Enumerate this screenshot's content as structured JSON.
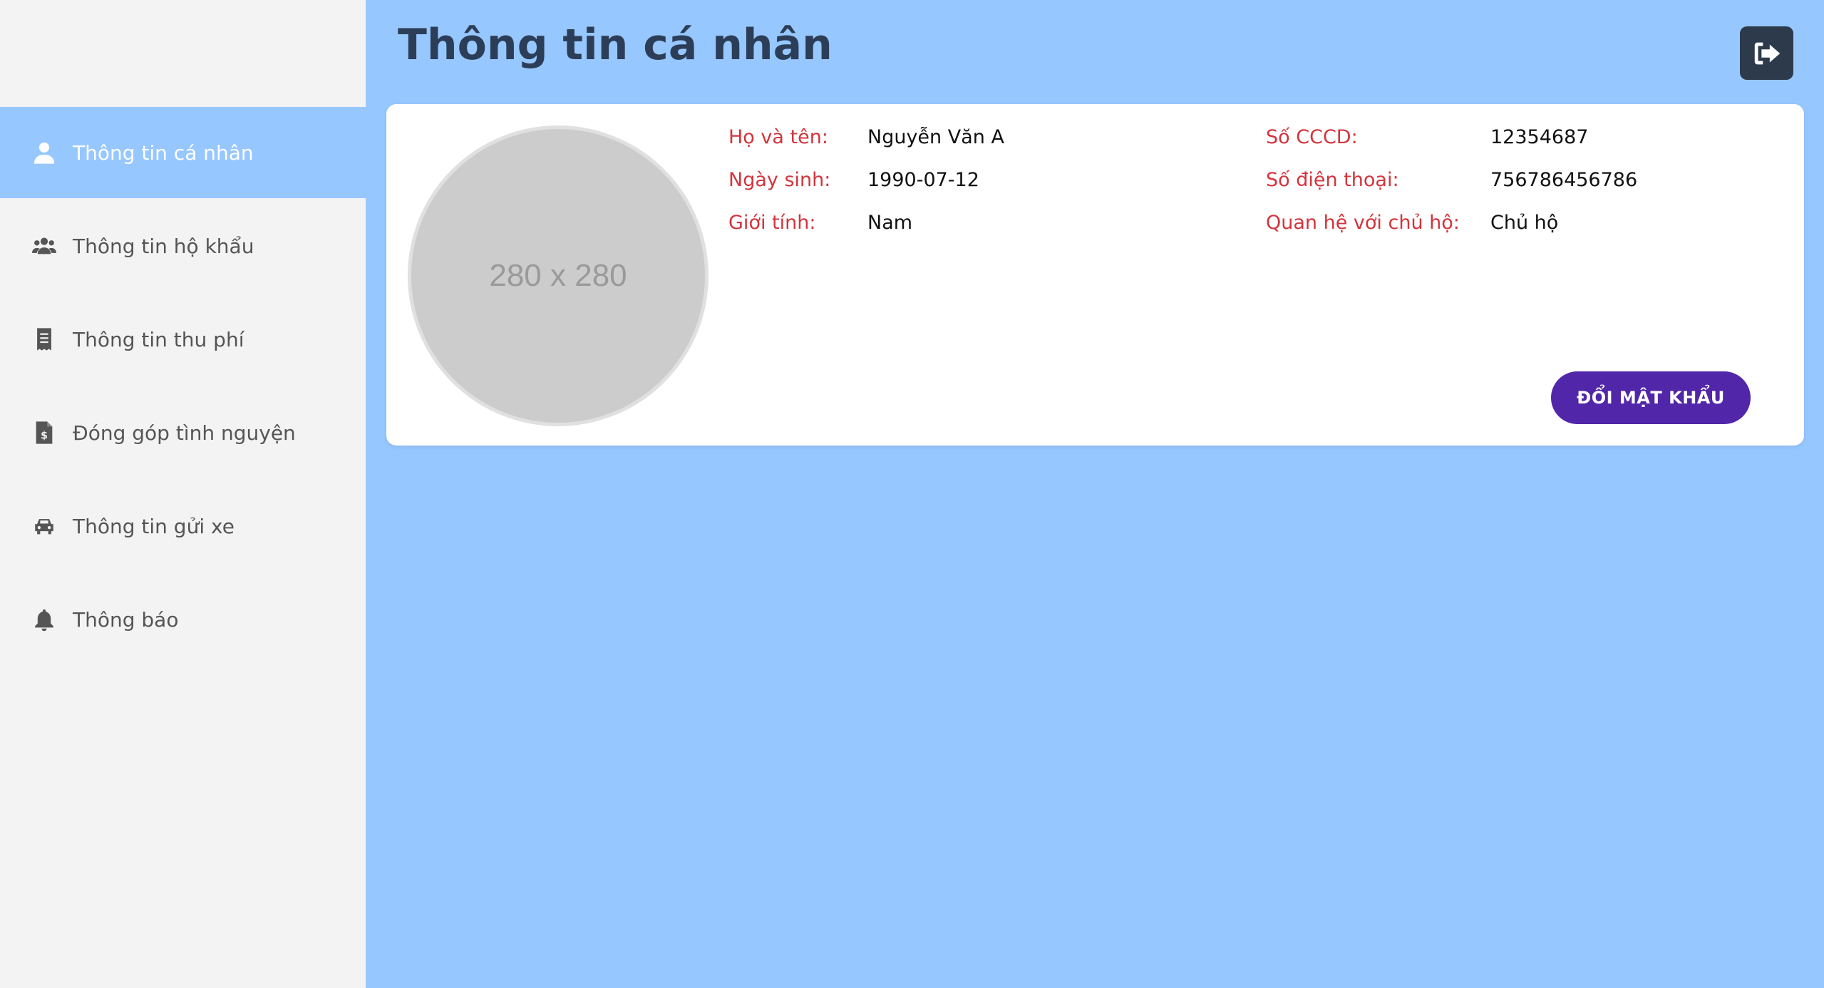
{
  "sidebar": {
    "items": [
      {
        "label": "Thông tin cá nhân",
        "icon": "user-icon",
        "active": true
      },
      {
        "label": "Thông tin hộ khẩu",
        "icon": "users-icon",
        "active": false
      },
      {
        "label": "Thông tin thu phí",
        "icon": "receipt-icon",
        "active": false
      },
      {
        "label": "Đóng góp tình nguyện",
        "icon": "invoice-dollar-icon",
        "active": false
      },
      {
        "label": "Thông tin gửi xe",
        "icon": "car-icon",
        "active": false
      },
      {
        "label": "Thông báo",
        "icon": "bell-icon",
        "active": false
      }
    ]
  },
  "header": {
    "title": "Thông tin cá nhân",
    "logout_icon": "sign-out-icon"
  },
  "profile": {
    "avatar_placeholder": "280 x 280",
    "fields_left": [
      {
        "label": "Họ và tên:",
        "value": "Nguyễn Văn A"
      },
      {
        "label": "Ngày sinh:",
        "value": "1990-07-12"
      },
      {
        "label": "Giới tính:",
        "value": "Nam"
      }
    ],
    "fields_right": [
      {
        "label": "Số CCCD:",
        "value": "12354687"
      },
      {
        "label": "Số điện thoại:",
        "value": "756786456786"
      },
      {
        "label": "Quan hệ với chủ hộ:",
        "value": "Chủ hộ"
      }
    ],
    "change_password_label": "ĐỔI MẬT KHẨU"
  },
  "colors": {
    "background": "#97c7ff",
    "sidebar": "#f3f3f3",
    "label_red": "#d3343c",
    "title": "#2c3e57",
    "button_purple": "#5126a8",
    "logout_button": "#2d3a4c"
  }
}
